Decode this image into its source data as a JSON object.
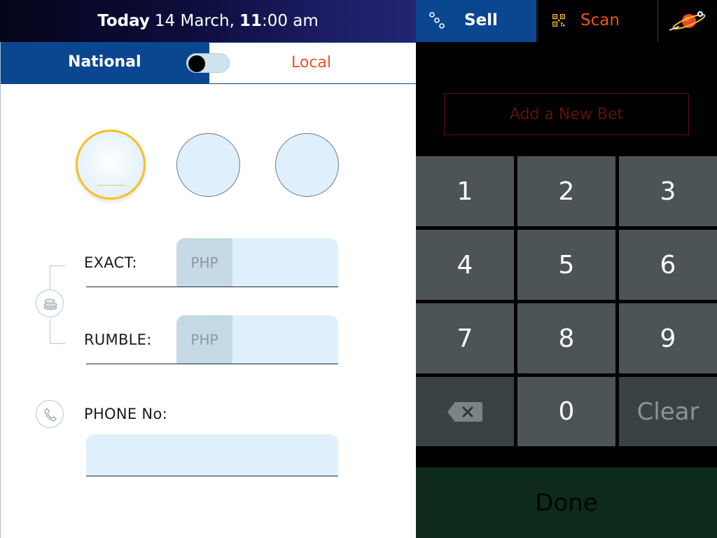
{
  "header": {
    "date_today": "Today",
    "date_day": "14 March,",
    "date_hour": "11",
    "date_rest": ":00 am",
    "sell_label": "Sell",
    "scan_label": "Scan",
    "sell_icon": "link-dots-icon",
    "scan_icon": "qr-code-icon",
    "logo_icon": "planet-logo-icon"
  },
  "tabs": {
    "national_label": "National",
    "local_label": "Local",
    "toggle_state": "national"
  },
  "form": {
    "exact_label": "EXACT:",
    "exact_prefix": "PHP",
    "exact_value": "",
    "rumble_label": "RUMBLE:",
    "rumble_prefix": "PHP",
    "rumble_value": "",
    "phone_label": "PHONE No:",
    "phone_value": ""
  },
  "keypad": {
    "new_bet_label": "Add a New Bet",
    "keys": [
      "1",
      "2",
      "3",
      "4",
      "5",
      "6",
      "7",
      "8",
      "9"
    ],
    "zero": "0",
    "clear_label": "Clear",
    "backspace_icon": "backspace-icon",
    "done_label": "Done"
  },
  "colors": {
    "brand_blue": "#0b4691",
    "accent_orange": "#ee5322",
    "selected_ring": "#f6c020",
    "key_gray": "#4c5455",
    "done_green": "#0e2a1c"
  }
}
